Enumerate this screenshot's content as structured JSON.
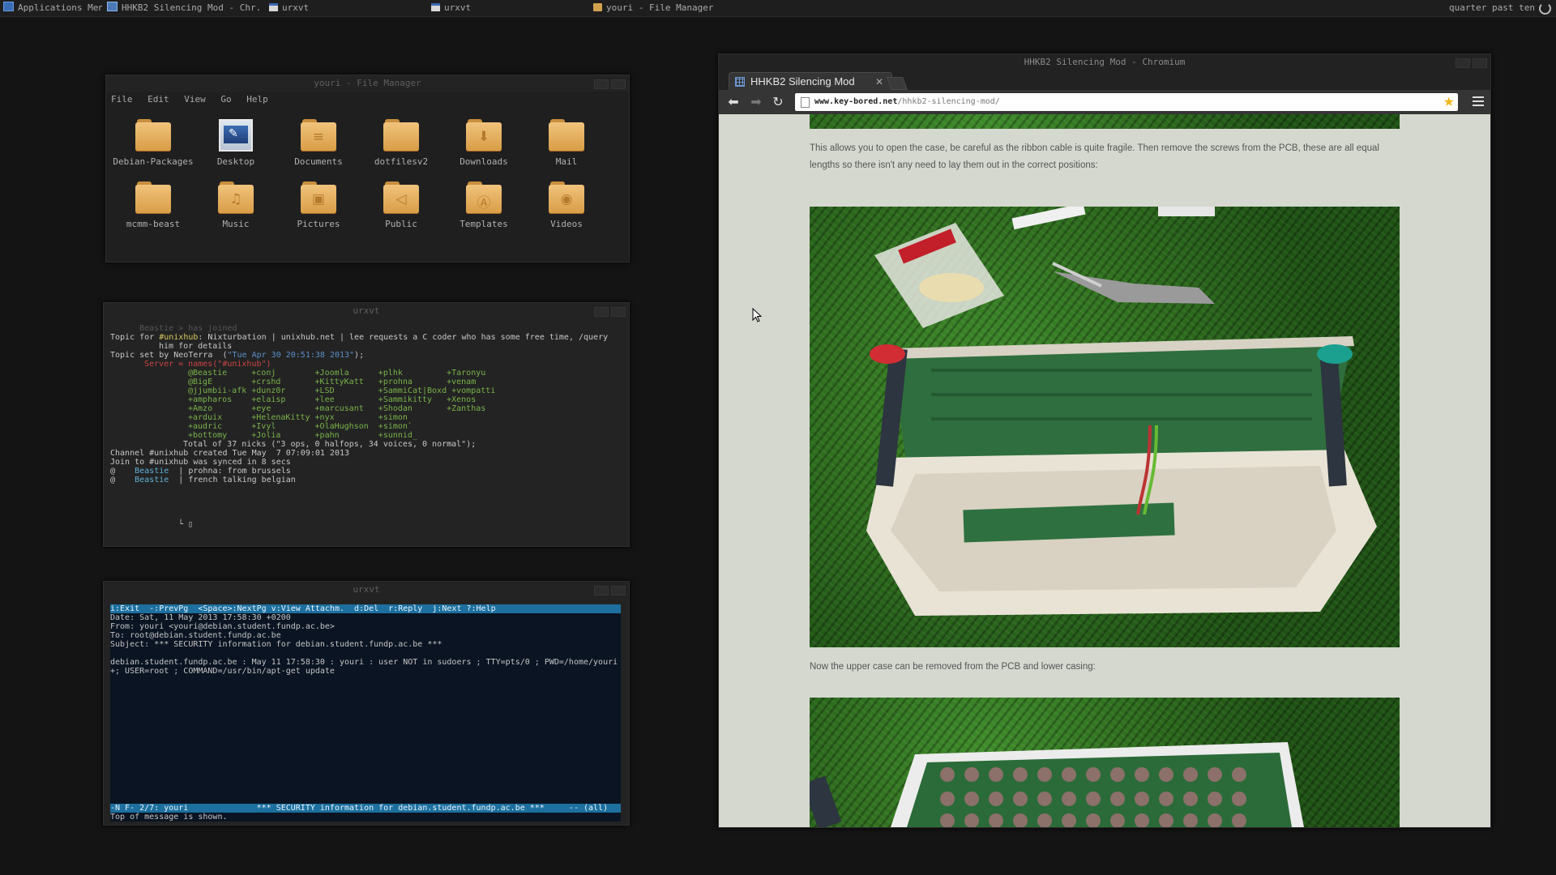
{
  "panel": {
    "tasks": [
      {
        "label": "Applications Menu"
      },
      {
        "label": "HHKB2 Silencing Mod - Chr..."
      },
      {
        "label": "urxvt"
      },
      {
        "label": "urxvt"
      },
      {
        "label": "youri - File Manager"
      }
    ],
    "clock": "quarter past ten"
  },
  "file_manager": {
    "title": "youri - File Manager",
    "menu": [
      "File",
      "Edit",
      "View",
      "Go",
      "Help"
    ],
    "items": [
      {
        "label": "Debian-Packages",
        "icon": "folder-icon"
      },
      {
        "label": "Desktop",
        "icon": "desktop-icon"
      },
      {
        "label": "Documents",
        "icon": "documents-folder-icon"
      },
      {
        "label": "dotfilesv2",
        "icon": "folder-icon"
      },
      {
        "label": "Downloads",
        "icon": "downloads-folder-icon"
      },
      {
        "label": "Mail",
        "icon": "folder-icon"
      },
      {
        "label": "mcmm-beast",
        "icon": "folder-icon"
      },
      {
        "label": "Music",
        "icon": "music-folder-icon"
      },
      {
        "label": "Pictures",
        "icon": "pictures-folder-icon"
      },
      {
        "label": "Public",
        "icon": "public-folder-icon"
      },
      {
        "label": "Templates",
        "icon": "templates-folder-icon"
      },
      {
        "label": "Videos",
        "icon": "videos-folder-icon"
      }
    ]
  },
  "irc": {
    "title": "urxvt",
    "joined": "Beastie > has joined",
    "topic_prefix": "Topic for ",
    "channel": "#unixhub",
    "topic_text": ": Nixturbation | unixhub.net | lee requests a C coder who has some free time, /query",
    "topic_text2": "him for details",
    "topic_set": "Topic set by NeoTerra  (",
    "topic_date": "\"Tue Apr 30 20:51:38 2013\"",
    "topic_close": ");",
    "server_line": "Server = names(\"#unixhub\")",
    "nick_rows": [
      "@Beastie     +conj        +Joomla      +plhk         +Taronyu",
      "@BigE        +crshd       +KittyKatt   +prohna       +venam",
      "@jjumbii-afk +dunz0r      +LSD         +SammiCat|Boxd +vompatti",
      "+ampharos    +elaisp      +lee         +Sammikitty   +Xenos",
      "+Amzo        +eye         +marcusant   +Shodan       +Zanthas",
      "+arduix      +HelenaKitty +nyx         +simon",
      "+audric      +Ivyl        +OlaHughson  +simon`",
      "+bottomy     +Jolia       +pahn        +sunnid_"
    ],
    "total_line": "Total of 37 nicks (\"3 ops, 0 halfops, 34 voices, 0 normal\");",
    "created_line": "Channel #unixhub created Tue May  7 07:09:01 2013",
    "sync_line": "Join to #unixhub was synced in 8 secs",
    "msg1_nick": "Beastie",
    "msg1_text": "prohna: from brussels",
    "msg2_nick": "Beastie",
    "msg2_text": "french talking belgian",
    "prompt": "└ ▯"
  },
  "mutt": {
    "title": "urxvt",
    "help_bar": "i:Exit  -:PrevPg  <Space>:NextPg v:View Attachm.  d:Del  r:Reply  j:Next ?:Help",
    "date": "Date: Sat, 11 May 2013 17:58:30 +0200",
    "from": "From: youri <youri@debian.student.fundp.ac.be>",
    "to": "To: root@debian.student.fundp.ac.be",
    "subject": "Subject: *** SECURITY information for debian.student.fundp.ac.be ***",
    "body1": "debian.student.fundp.ac.be : May 11 17:58:30 : youri : user NOT in sudoers ; TTY=pts/0 ; PWD=/home/youri",
    "body2": "+; USER=root ; COMMAND=/usr/bin/apt-get update",
    "status_bar": "-N F- 2/7: youri              *** SECURITY information for debian.student.fundp.ac.be ***     -- (all)",
    "footer": "Top of message is shown."
  },
  "chromium": {
    "title": "HHKB2 Silencing Mod - Chromium",
    "tab_label": "HHKB2 Silencing Mod",
    "url_host": "www.key-bored.net",
    "url_path": "/hhkb2-silencing-mod/",
    "para1": "This allows you to open the case, be careful as the ribbon cable is quite fragile. Then remove the screws from the PCB, these are all equal lengths so there isn't any need to lay them out in the correct positions:",
    "para2": "Now the upper case can be removed from the PCB and lower casing:"
  },
  "colors": {
    "desktop_bg": "#141414",
    "mutt_bar": "#1c6f9e",
    "folder": "#e0ab5c",
    "page_bg": "#d5d8cf"
  }
}
